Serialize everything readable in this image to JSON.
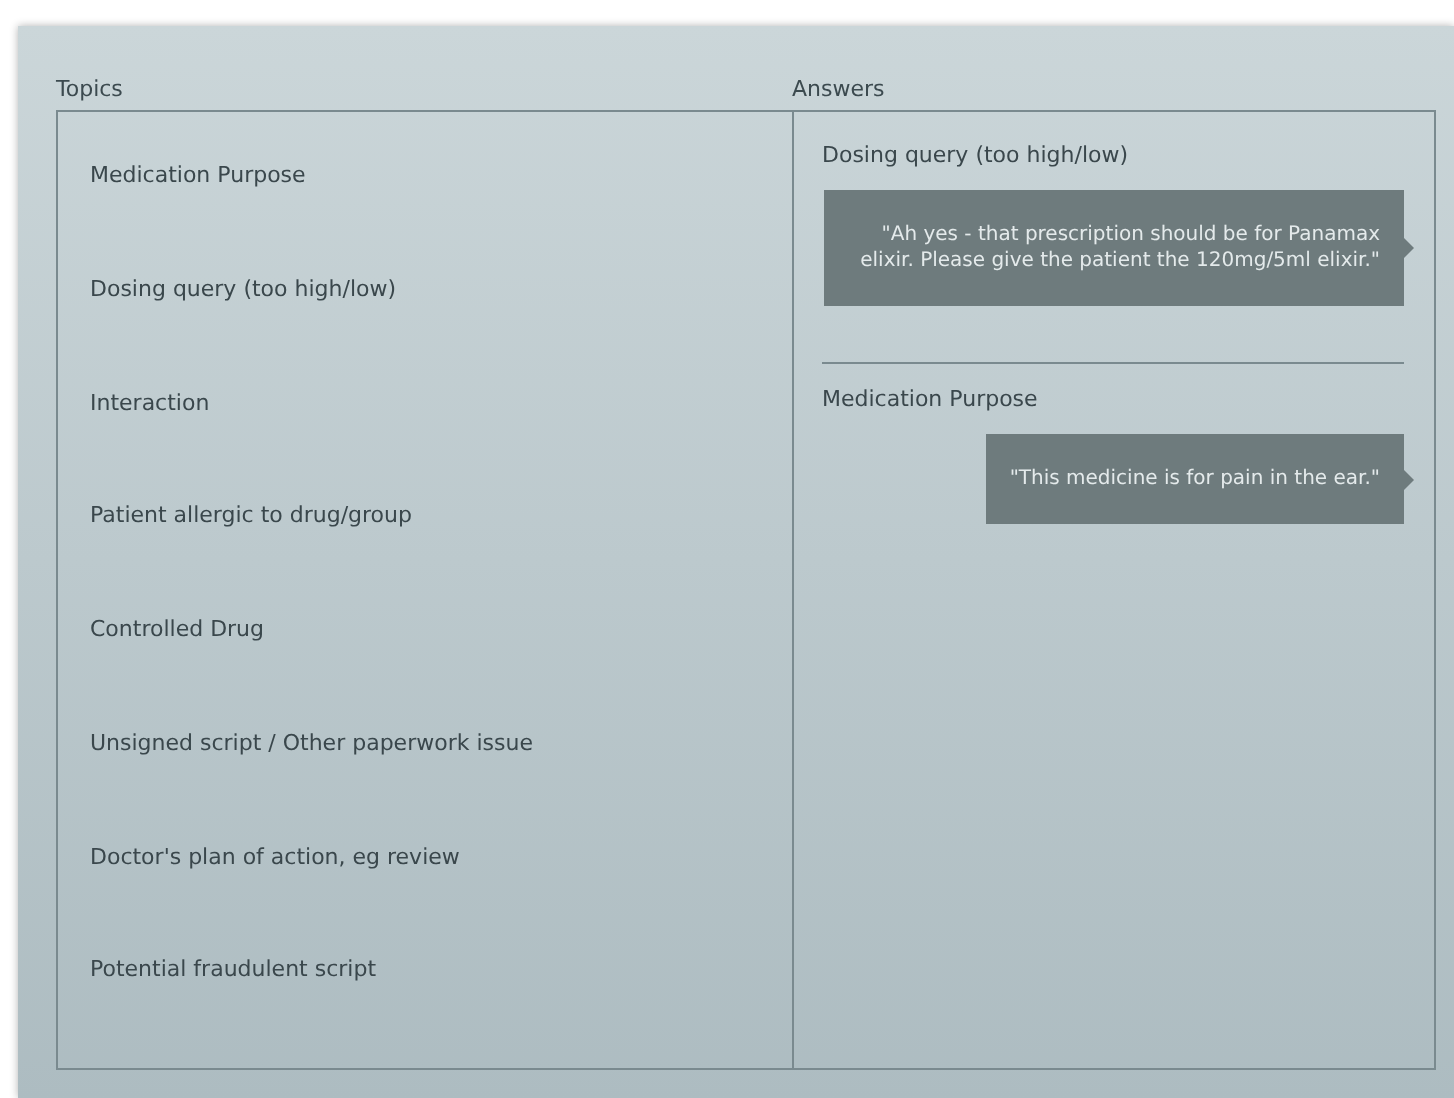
{
  "topics_label": "Topics",
  "answers_label": "Answers",
  "topics": [
    "Medication Purpose",
    "Dosing query (too high/low)",
    "Interaction",
    "Patient allergic to drug/group",
    "Controlled Drug",
    "Unsigned script / Other paperwork issue",
    "Doctor's plan of action, eg review",
    "Potential fraudulent script"
  ],
  "answers": [
    {
      "topic": "Dosing query (too high/low)",
      "reply": "\"Ah yes - that prescription should be for Panamax elixir. Please give the patient the 120mg/5ml elixir.\""
    },
    {
      "topic": "Medication Purpose",
      "reply": "\"This medicine is for pain in the ear.\""
    }
  ]
}
